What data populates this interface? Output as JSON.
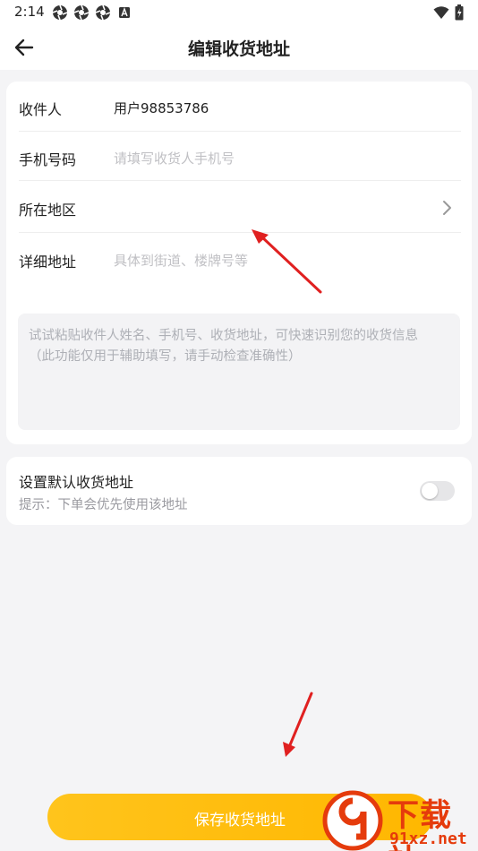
{
  "status_bar": {
    "time": "2:14",
    "left_icons": [
      "aperture-icon",
      "aperture-icon",
      "aperture-icon",
      "font-app-icon"
    ],
    "right_icons": [
      "wifi-icon",
      "battery-charging-icon"
    ]
  },
  "header": {
    "title": "编辑收货地址",
    "back_icon": "arrow-left-icon"
  },
  "form": {
    "recipient": {
      "label": "收件人",
      "value": "用户98853786"
    },
    "phone": {
      "label": "手机号码",
      "placeholder": "请填写收货人手机号"
    },
    "region": {
      "label": "所在地区",
      "chevron_icon": "chevron-right-icon"
    },
    "detail": {
      "label": "详细地址",
      "placeholder": "具体到街道、楼牌号等"
    },
    "paste_box": {
      "placeholder_line1": "试试粘贴收件人姓名、手机号、收货地址，可快速识别您的收货信息",
      "placeholder_line2": "（此功能仅用于辅助填写，请手动检查准确性）"
    }
  },
  "default_setting": {
    "title": "设置默认收货地址",
    "hint": "提示：下单会优先使用该地址",
    "enabled": false
  },
  "save_button": {
    "label": "保存收货地址"
  },
  "watermark": {
    "text": "下载站",
    "url": "91xz.net"
  },
  "colors": {
    "accent": "#ffbd0c",
    "annotation_arrow": "#e02020",
    "watermark": "#e53b0c"
  }
}
